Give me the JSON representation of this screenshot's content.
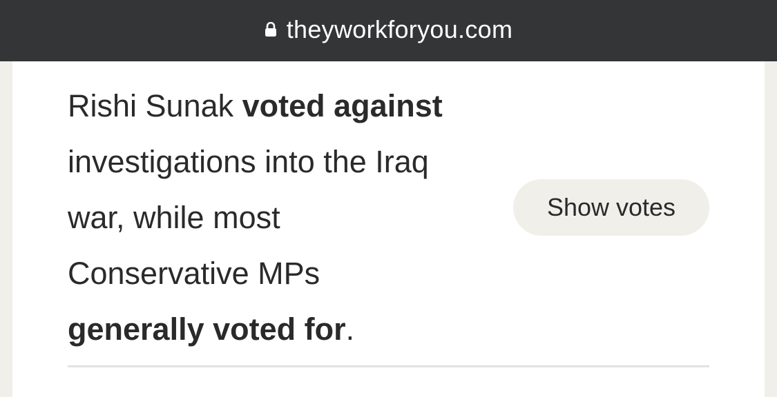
{
  "browser": {
    "url": "theyworkforyou.com",
    "lock_icon": "lock-icon"
  },
  "vote_statement": {
    "mp_name": "Rishi Sunak",
    "mp_vote": "voted against",
    "policy": "investigations into the Iraq war, while most Conservative MPs",
    "party_vote": "generally voted for",
    "end": "."
  },
  "actions": {
    "show_votes_label": "Show votes"
  },
  "colors": {
    "url_bar_bg": "#343537",
    "page_bg": "#f0efea",
    "card_bg": "#ffffff",
    "text": "#2a2a2a",
    "button_bg": "#f0efea"
  }
}
